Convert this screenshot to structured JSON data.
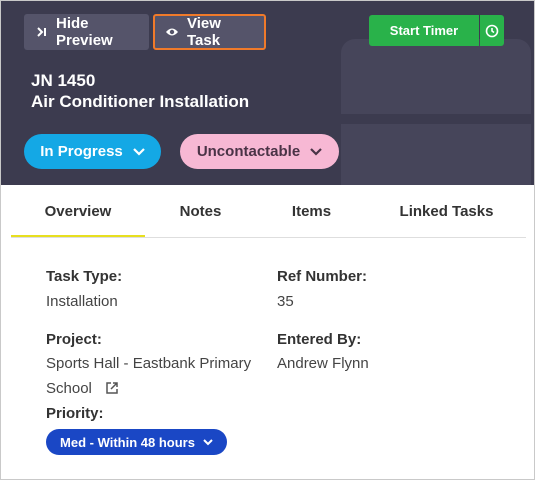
{
  "header": {
    "hide_preview_label": "Hide Preview",
    "view_task_label": "View Task",
    "start_timer_label": "Start Timer",
    "job_number": "JN 1450",
    "job_title": "Air Conditioner Installation",
    "status_label": "In Progress",
    "contact_status_label": "Uncontactable"
  },
  "tabs": [
    {
      "label": "Overview",
      "active": true
    },
    {
      "label": "Notes"
    },
    {
      "label": "Items"
    },
    {
      "label": "Linked Tasks"
    }
  ],
  "details": {
    "task_type_label": "Task Type:",
    "task_type_value": "Installation",
    "ref_number_label": "Ref Number:",
    "ref_number_value": "35",
    "project_label": "Project:",
    "project_value_line1": "Sports Hall - Eastbank Primary",
    "project_value_line2": "School",
    "entered_by_label": "Entered By:",
    "entered_by_value": "Andrew Flynn",
    "priority_label": "Priority:",
    "priority_value": "Med - Within 48 hours"
  },
  "colors": {
    "header_bg": "#3c3b4f",
    "header_button_bg": "#55546a",
    "highlight_border": "#f07a2a",
    "timer_green": "#29b24a",
    "status_blue": "#14a8e5",
    "contact_pink": "#f7b8d4",
    "tab_underline": "#e7df1f",
    "priority_blue": "#1a47c5"
  },
  "icons": {
    "collapse": "collapse-right-icon",
    "view": "eye-icon",
    "timer": "clock-icon",
    "dropdown": "chevron-down-icon",
    "external": "external-link-icon",
    "background": "briefcase-icon"
  }
}
